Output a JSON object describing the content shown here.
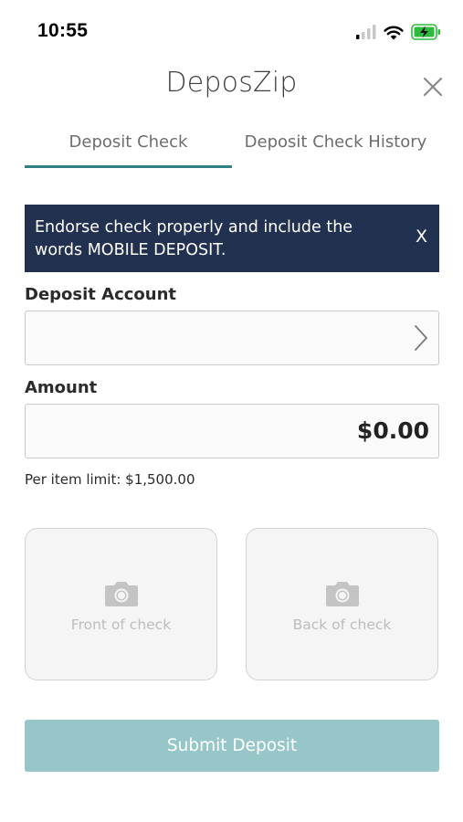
{
  "status_bar": {
    "time": "10:55",
    "icons": [
      "cellular-signal-icon",
      "wifi-icon",
      "battery-charging-icon"
    ]
  },
  "header": {
    "title": "DeposZip",
    "close_icon": "close-icon"
  },
  "tabs": [
    {
      "label": "Deposit Check",
      "active": true
    },
    {
      "label": "Deposit Check History",
      "active": false
    }
  ],
  "banner": {
    "text": "Endorse check properly and include the words MOBILE DEPOSIT.",
    "close_label": "X"
  },
  "form": {
    "account_label": "Deposit Account",
    "account_value": "",
    "amount_label": "Amount",
    "amount_value": "$0.00",
    "limit_text": "Per item limit: $1,500.00"
  },
  "capture": {
    "front_label": "Front of check",
    "back_label": "Back of check"
  },
  "submit": {
    "label": "Submit Deposit"
  },
  "colors": {
    "accent": "#2f7f84",
    "banner_bg": "#223150",
    "submit_disabled": "#97c6c8"
  }
}
